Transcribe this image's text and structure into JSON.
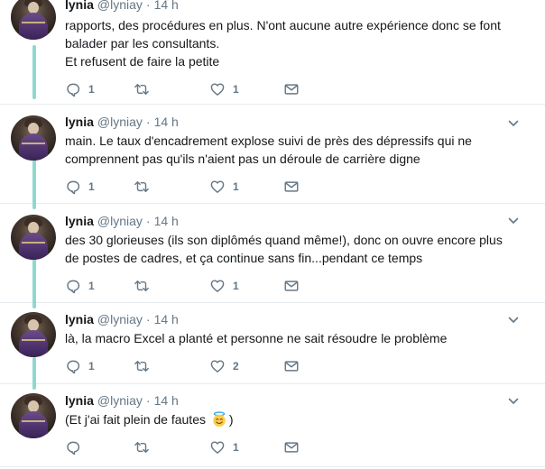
{
  "tweets": [
    {
      "name": "lynia",
      "handle": "@lyniay",
      "dot": "·",
      "time": "14 h",
      "lines": [
        "rapports, des procédures en plus. N'ont aucune autre expérience donc se font",
        "balader par les consultants.",
        "Et refusent de faire la petite"
      ],
      "replies": "1",
      "retweets": "",
      "likes": "1"
    },
    {
      "name": "lynia",
      "handle": "@lyniay",
      "dot": "·",
      "time": "14 h",
      "lines": [
        "main. Le taux d'encadrement explose suivi de près des dépressifs qui ne",
        "comprennent pas qu'ils n'aient pas un déroule de carrière digne"
      ],
      "replies": "1",
      "retweets": "",
      "likes": "1"
    },
    {
      "name": "lynia",
      "handle": "@lyniay",
      "dot": "·",
      "time": "14 h",
      "lines": [
        "des 30 glorieuses (ils son diplômés quand même!), donc on ouvre encore plus",
        "de postes de cadres, et ça continue sans fin...pendant ce temps"
      ],
      "replies": "1",
      "retweets": "",
      "likes": "1"
    },
    {
      "name": "lynia",
      "handle": "@lyniay",
      "dot": "·",
      "time": "14 h",
      "lines": [
        "là, la macro Excel a planté et personne ne sait résoudre le problème"
      ],
      "replies": "1",
      "retweets": "",
      "likes": "2"
    },
    {
      "name": "lynia",
      "handle": "@lyniay",
      "dot": "·",
      "time": "14 h",
      "text_before_emoji": "(Et j'ai fait plein de fautes ",
      "text_after_emoji": ")",
      "emoji": "smiling-face-with-halo",
      "replies": "",
      "retweets": "",
      "likes": "1"
    }
  ],
  "icons": {
    "reply": "reply-icon",
    "retweet": "retweet-icon",
    "like": "heart-icon",
    "dm": "envelope-icon",
    "menu": "chevron-down-icon"
  },
  "colors": {
    "thread_line": "#8fd8cd",
    "muted_text": "#657786",
    "body_text": "#14171a",
    "divider": "#e6ecf0"
  }
}
